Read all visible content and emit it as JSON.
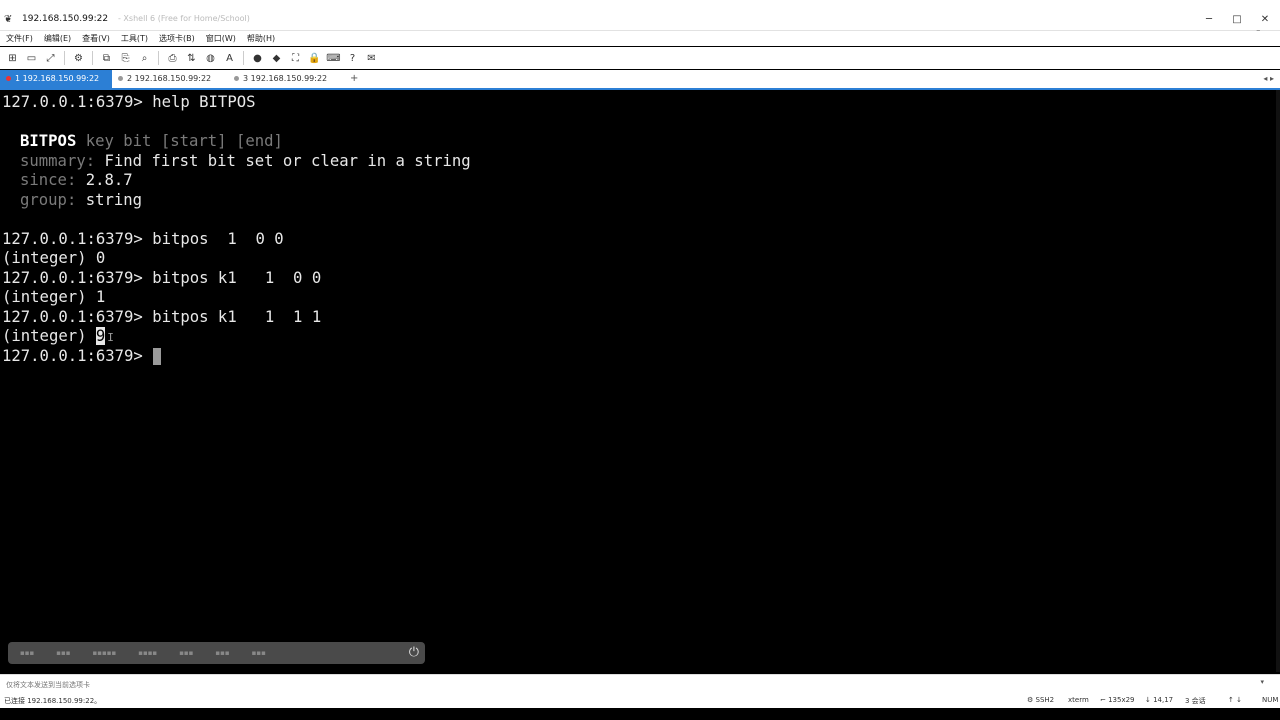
{
  "window": {
    "title": "192.168.150.99:22",
    "subtitle": "- Xshell 6 (Free for Home/School)",
    "controls": [
      "─",
      "□",
      "✕"
    ]
  },
  "menu": [
    "文件(F)",
    "编辑(E)",
    "查看(V)",
    "工具(T)",
    "选项卡(B)",
    "窗口(W)",
    "帮助(H)"
  ],
  "toolbar_icons": [
    "new-session-icon",
    "open-folder-icon",
    "reconnect-icon",
    "properties-icon",
    "copy-icon",
    "paste-icon",
    "find-icon",
    "print-icon",
    "transfer-icon",
    "globe-icon",
    "font-icon",
    "xftp-icon",
    "xagent-icon",
    "fullscreen-icon",
    "lock-icon",
    "keyboard-icon",
    "help-icon",
    "chat-icon"
  ],
  "tabs": [
    {
      "label": "1 192.168.150.99:22",
      "active": true
    },
    {
      "label": "2 192.168.150.99:22",
      "active": false
    },
    {
      "label": "3 192.168.150.99:22",
      "active": false
    }
  ],
  "tab_add": "+",
  "terminal": {
    "prompt": "127.0.0.1:6379>",
    "line1_cmd": " help BITPOS",
    "help_cmd": "BITPOS",
    "help_args": " key bit [start] [end]",
    "summary_label": "summary:",
    "summary_value": " Find first bit set or clear in a string",
    "since_label": "since:",
    "since_value": " 2.8.7",
    "group_label": "group:",
    "group_value": " string",
    "cmd2": " bitpos  1  0 0",
    "result2": "(integer) 0",
    "cmd3": " bitpos k1   1  0 0",
    "result3": "(integer) 1",
    "cmd4": " bitpos k1   1  1 1",
    "result4_prefix": "(integer) ",
    "result4_value": "9"
  },
  "quickbar": {
    "buttons": [
      "▪▪▪",
      "▪▪▪",
      "▪▪▪▪▪",
      "▪▪▪▪",
      "▪▪▪",
      "▪▪▪",
      "▪▪▪"
    ],
    "power": "⏻"
  },
  "input_placeholder": "仅将文本发送到当前选项卡",
  "status": {
    "connection": "已连接 192.168.150.99:22。",
    "protocol": "SSH2",
    "term": "xterm",
    "size": "135x29",
    "cursor_pos": "14,17",
    "sessions": "3 会话",
    "caps": "NUM"
  }
}
